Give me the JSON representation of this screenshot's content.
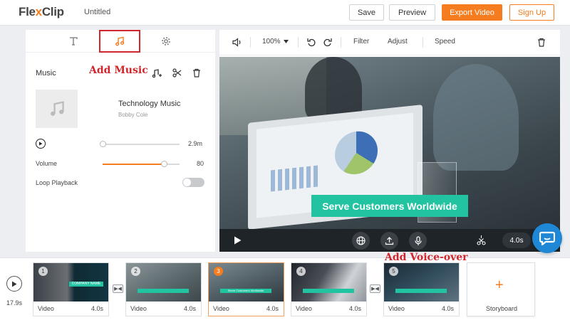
{
  "header": {
    "logo_prefix": "Fle",
    "logo_x": "x",
    "logo_suffix": "Clip",
    "doc_title": "Untitled",
    "save_label": "Save",
    "preview_label": "Preview",
    "export_label": "Export Video",
    "signup_label": "Sign Up",
    "accent_color": "#f57c1f"
  },
  "left_panel": {
    "tabs": [
      {
        "icon": "text-icon",
        "active": false
      },
      {
        "icon": "music-note-icon",
        "active": true
      },
      {
        "icon": "gear-icon",
        "active": false
      }
    ],
    "section_title": "Music",
    "annotation_add_music": "Add Music",
    "music": {
      "name": "Technology Music",
      "artist": "Bobby Cole",
      "duration_label": "2.9m",
      "playhead_fraction": 0.0
    },
    "volume": {
      "label": "Volume",
      "value": "80",
      "fraction": 0.8
    },
    "loop": {
      "label": "Loop Playback",
      "on": false
    }
  },
  "editor": {
    "toolbar": {
      "zoom": "100%",
      "filter_label": "Filter",
      "adjust_label": "Adjust",
      "speed_label": "Speed"
    },
    "banner_text": "Serve Customers Worldwide",
    "duration": "4.0s"
  },
  "timeline": {
    "total_duration": "17.9s",
    "annotation_voice_over": "Add Voice-over",
    "clips": [
      {
        "num": "1",
        "type": "Video",
        "duration": "4.0s"
      },
      {
        "num": "2",
        "type": "Video",
        "duration": "4.0s"
      },
      {
        "num": "3",
        "type": "Video",
        "duration": "4.0s",
        "active": true
      },
      {
        "num": "4",
        "type": "Video",
        "duration": "4.0s"
      },
      {
        "num": "5",
        "type": "Video",
        "duration": "4.0s"
      }
    ],
    "clip_captions": [
      "COMPANY NAME",
      "",
      "Serve Customers Worldwide",
      "",
      ""
    ],
    "storyboard_label": "Storyboard"
  }
}
